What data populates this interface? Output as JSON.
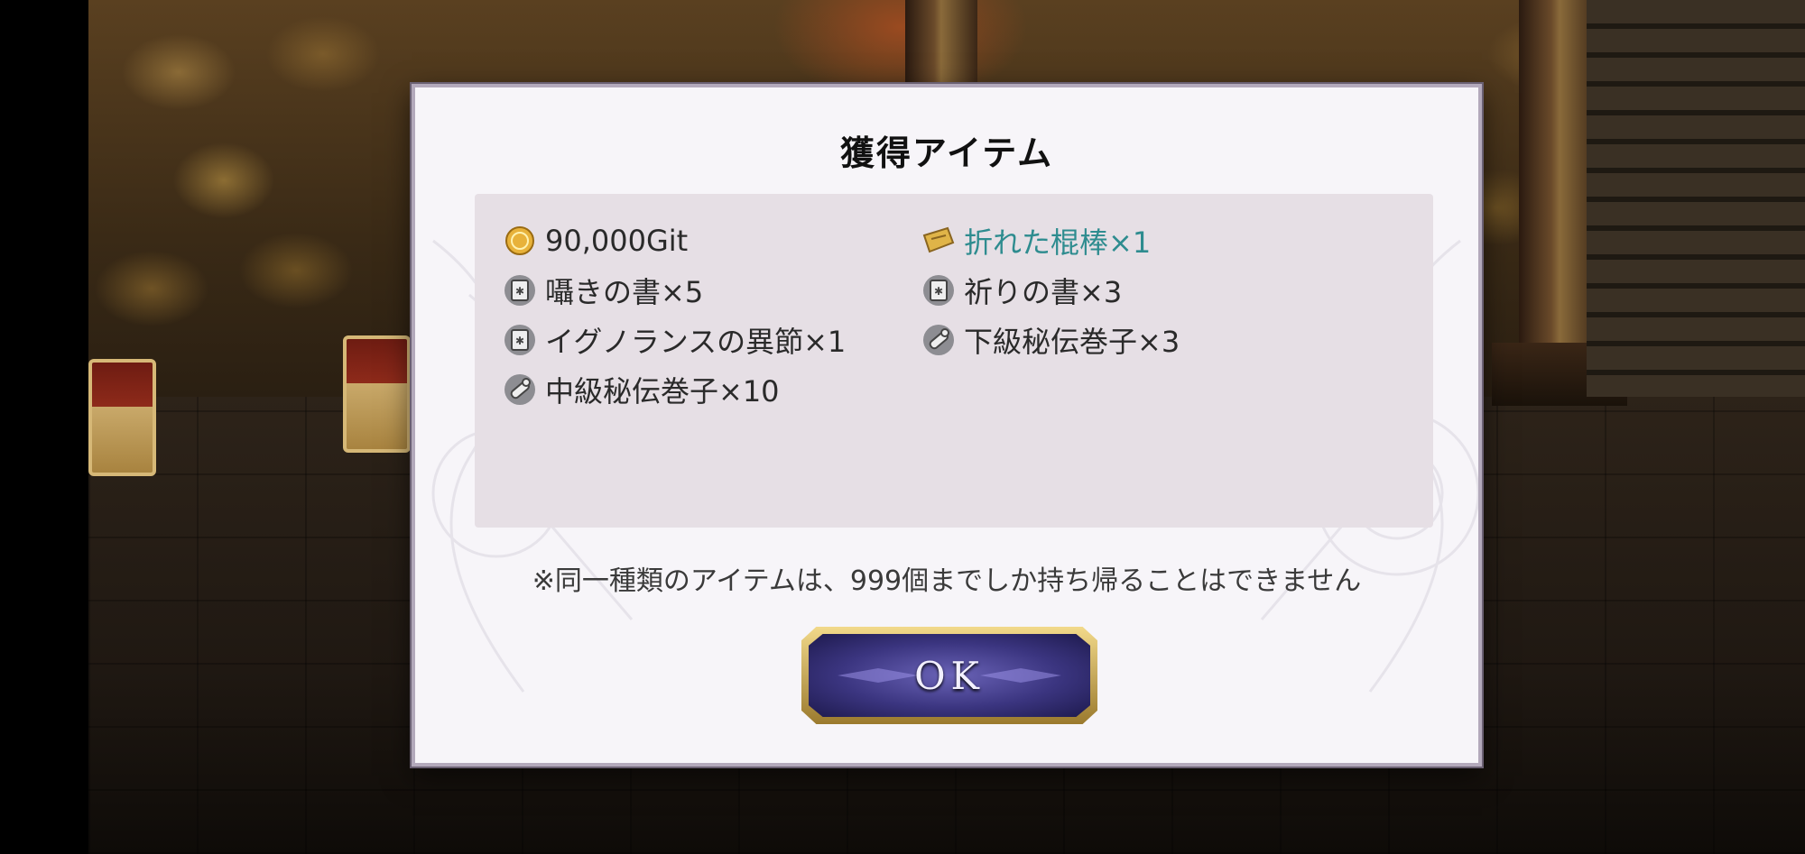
{
  "dialog": {
    "title": "獲得アイテム",
    "items": [
      {
        "label": "90,000Git",
        "icon": "gold-coin-icon"
      },
      {
        "label": "折れた棍棒×1",
        "icon": "broken-club-icon",
        "highlight_color": "#2e8c8f"
      },
      {
        "label": "囁きの書×5",
        "icon": "book-icon"
      },
      {
        "label": "祈りの書×3",
        "icon": "book-icon"
      },
      {
        "label": "イグノランスの異節×1",
        "icon": "book-icon"
      },
      {
        "label": "下級秘伝巻子×3",
        "icon": "scroll-icon"
      },
      {
        "label": "中級秘伝巻子×10",
        "icon": "scroll-icon"
      }
    ],
    "note": "※同一種類のアイテムは、999個までしか持ち帰ることはできません",
    "ok_label": "OK"
  },
  "colors": {
    "panel_background": "#e6dfe5",
    "dialog_background": "#f7f5f9",
    "button_accent": "#3b3580",
    "button_frame": "#d6b877"
  }
}
